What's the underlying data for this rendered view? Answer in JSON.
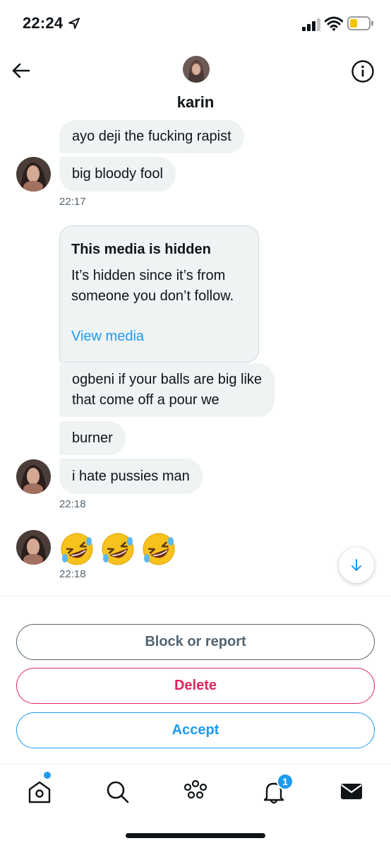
{
  "status_bar": {
    "time": "22:24"
  },
  "header": {
    "name": "karin"
  },
  "messages": {
    "m1": "ayo deji the fucking rapist",
    "m2": "big bloody fool",
    "ts1": "22:17",
    "media": {
      "title": "This media is hidden",
      "text": "It’s hidden since it’s from someone you don’t follow.",
      "link": "View media"
    },
    "m3_line1": "ogbeni if your balls are big like",
    "m3_line2": "that come off a pour we",
    "m4": "burner",
    "m5": "i hate pussies man",
    "ts2": "22:18",
    "ts3": "22:18"
  },
  "actions": {
    "block": "Block or report",
    "delete": "Delete",
    "accept": "Accept"
  },
  "tabs": {
    "notifications_badge": "1"
  },
  "colors": {
    "accent": "#1d9bf0",
    "danger": "#e0245e",
    "bubble": "#eff3f4",
    "muted": "#536471"
  }
}
